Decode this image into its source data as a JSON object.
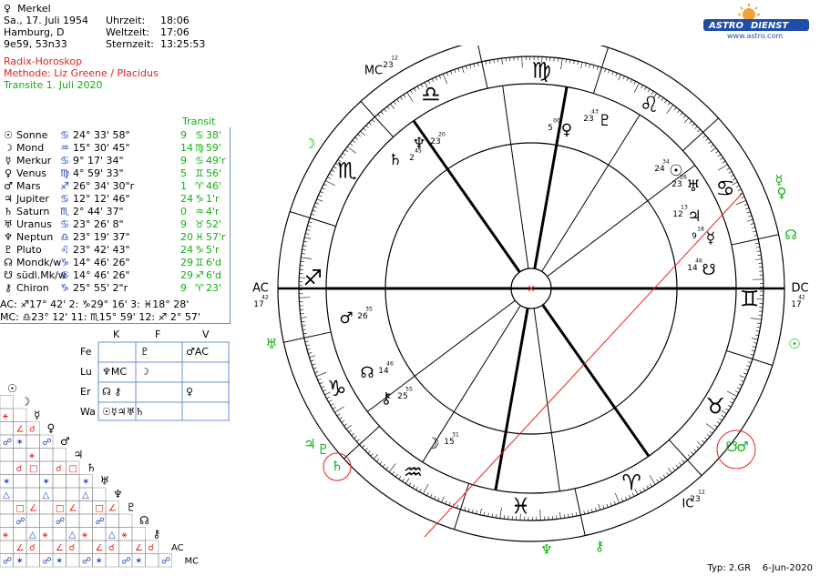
{
  "header": {
    "name_symbol": "♀",
    "name": "Merkel",
    "date": "Sa., 17. Juli 1954",
    "place": "Hamburg, D",
    "coords": "9e59, 53n33",
    "time_label": "Uhrzeit:",
    "time_value": "18:06",
    "worldtime_label": "Weltzeit:",
    "worldtime_value": "17:06",
    "sidereal_label": "Sternzeit:",
    "sidereal_value": "13:25:53",
    "chart_type": "Radix-Horoskop",
    "method": "Methode: Liz Greene / Placidus",
    "transit_title": "Transite 1. Juli 2020"
  },
  "logo": {
    "brand_left": "ASTRO",
    "brand_right": "DIENST",
    "url": "www.astro.com"
  },
  "planet_table": {
    "transit_header": "Transit",
    "rows": [
      {
        "symbol": "☉",
        "name": "Sonne",
        "sign": "♋",
        "pos": "24° 33' 58\"",
        "tdeg": "9",
        "tsign": "♋",
        "tmin": "38'"
      },
      {
        "symbol": "☽",
        "name": "Mond",
        "sign": "♒",
        "pos": "15° 30' 45\"",
        "tdeg": "14",
        "tsign": "♍",
        "tmin": "59'"
      },
      {
        "symbol": "☿",
        "name": "Merkur",
        "sign": "♋",
        "pos": "9° 17' 34\"",
        "tdeg": "9",
        "tsign": "♋",
        "tmin": "49'r"
      },
      {
        "symbol": "♀",
        "name": "Venus",
        "sign": "♍",
        "pos": "4° 59' 33\"",
        "tdeg": "5",
        "tsign": "♊",
        "tmin": "56'"
      },
      {
        "symbol": "♂",
        "name": "Mars",
        "sign": "♐",
        "pos": "26° 34' 30\"r",
        "tdeg": "1",
        "tsign": "♈",
        "tmin": "46'"
      },
      {
        "symbol": "♃",
        "name": "Jupiter",
        "sign": "♋",
        "pos": "12° 12' 46\"",
        "tdeg": "24",
        "tsign": "♑",
        "tmin": "1'r"
      },
      {
        "symbol": "♄",
        "name": "Saturn",
        "sign": "♏",
        "pos": "2° 44' 37\"",
        "tdeg": "0",
        "tsign": "♒",
        "tmin": "4'r"
      },
      {
        "symbol": "♅",
        "name": "Uranus",
        "sign": "♋",
        "pos": "23° 26' 8\"",
        "tdeg": "9",
        "tsign": "♉",
        "tmin": "52'"
      },
      {
        "symbol": "♆",
        "name": "Neptun",
        "sign": "♎",
        "pos": "23° 19' 37\"",
        "tdeg": "20",
        "tsign": "♓",
        "tmin": "57'r"
      },
      {
        "symbol": "♇",
        "name": "Pluto",
        "sign": "♌",
        "pos": "23° 42' 43\"",
        "tdeg": "24",
        "tsign": "♑",
        "tmin": "5'r"
      },
      {
        "symbol": "☊",
        "name": "Mondk/w",
        "sign": "♑",
        "pos": "14° 46' 26\"",
        "tdeg": "29",
        "tsign": "♊",
        "tmin": "6'd"
      },
      {
        "symbol": "☋",
        "name": "südl.Mk/w",
        "sign": "♋",
        "pos": "14° 46' 26\"",
        "tdeg": "29",
        "tsign": "♐",
        "tmin": "6'd"
      },
      {
        "symbol": "⚷",
        "name": "Chiron",
        "sign": "♑",
        "pos": "25° 55' 2\"r",
        "tdeg": "9",
        "tsign": "♈",
        "tmin": "23'"
      }
    ],
    "houses_line1": "AC: ♐17° 42'   2: ♑29° 16'   3: ♓18° 28'",
    "houses_line2": "MC: ♎23° 12'  11: ♏15° 59'  12: ♐ 2° 57'"
  },
  "element_table": {
    "col_headers": [
      "K",
      "F",
      "V"
    ],
    "row_headers": [
      "Fe",
      "Lu",
      "Er",
      "Wa"
    ],
    "cells": [
      [
        "",
        "♇",
        "♂AC"
      ],
      [
        "♆MC",
        "☽",
        ""
      ],
      [
        "☊ ⚷",
        "",
        "♀"
      ],
      [
        "☉☿♃♅♄",
        "",
        ""
      ]
    ]
  },
  "aspect_grid": {
    "planets": [
      "☉",
      "☽",
      "☿",
      "♀",
      "♂",
      "♃",
      "♄",
      "♅",
      "♆",
      "♇",
      "☊",
      "⚷",
      "AC",
      "MC"
    ]
  },
  "wheel": {
    "labels": {
      "ac": "AC",
      "dc": "DC",
      "mc": "MC",
      "ic": "IC"
    },
    "ac_deg": "17",
    "ac_min": "42",
    "dc_deg": "17",
    "dc_min": "42",
    "mc_deg": "23",
    "mc_min": "12",
    "ic_deg": "23",
    "ic_min": "12",
    "signs": [
      "♐",
      "♏",
      "♎",
      "♍",
      "♌",
      "♋",
      "♊",
      "♉",
      "♈",
      "♓",
      "♒",
      "♑"
    ],
    "natal": [
      {
        "sym": "♂",
        "deg": "26",
        "min": "35"
      },
      {
        "sym": "☊",
        "deg": "14",
        "min": "46"
      },
      {
        "sym": "⚷",
        "deg": "25",
        "min": "55"
      },
      {
        "sym": "☽",
        "deg": "15",
        "min": "31"
      },
      {
        "sym": "♆",
        "deg": "23",
        "min": "20"
      },
      {
        "sym": "♄",
        "deg": "2",
        "min": "45"
      },
      {
        "sym": "♀",
        "deg": "5",
        "min": "00"
      },
      {
        "sym": "♇",
        "deg": "23",
        "min": "43"
      },
      {
        "sym": "☉",
        "deg": "24",
        "min": "34"
      },
      {
        "sym": "♅",
        "deg": "23",
        "min": "26"
      },
      {
        "sym": "♃",
        "deg": "12",
        "min": "13"
      },
      {
        "sym": "☿",
        "deg": "9",
        "min": "18"
      },
      {
        "sym": "☋",
        "deg": "14",
        "min": "46"
      }
    ],
    "transits": [
      "☽",
      "♀",
      "☿",
      "☊",
      "☉",
      "♅",
      "♃",
      "♇",
      "♄",
      "☋",
      "♂",
      "♆",
      "⚷"
    ]
  },
  "footer": {
    "type": "Typ: 2.GR",
    "date": "6-Jun-2020"
  },
  "colors": {
    "blue_line": "#6f8fd0",
    "red": "#e8211c",
    "green": "#10b00f"
  }
}
